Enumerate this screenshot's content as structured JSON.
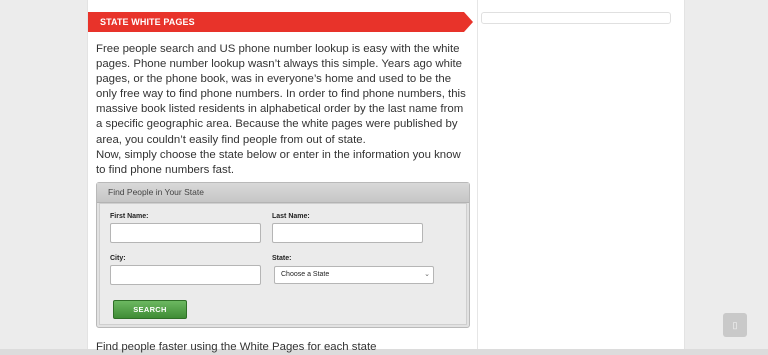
{
  "section": {
    "title": "STATE WHITE PAGES"
  },
  "intro": {
    "paragraph1": "Free people search and US phone number lookup is easy with the white pages. Phone number lookup wasn’t always this simple. Years ago white pages, or the phone book, was in everyone’s home and used to be the only free way to find phone numbers. In order to find phone numbers, this massive book listed residents in alphabetical order by the last name from a specific geographic area. Because the white pages were published by area, you couldn’t easily find people from out of state.",
    "paragraph2": "Now, simply choose the state below or enter in the information you know to find phone numbers fast."
  },
  "search_form": {
    "header": "Find People in Your State",
    "first_name_label": "First Name:",
    "first_name_value": "",
    "last_name_label": "Last Name:",
    "last_name_value": "",
    "city_label": "City:",
    "city_value": "",
    "state_label": "State:",
    "state_selected": "Choose a State",
    "search_button": "SEARCH"
  },
  "bottom": {
    "text": "Find people faster using the White Pages for each state"
  },
  "scroll_top": {
    "glyph": "▯"
  },
  "colors": {
    "accent_red": "#e8332a",
    "button_green": "#4a9a40"
  }
}
